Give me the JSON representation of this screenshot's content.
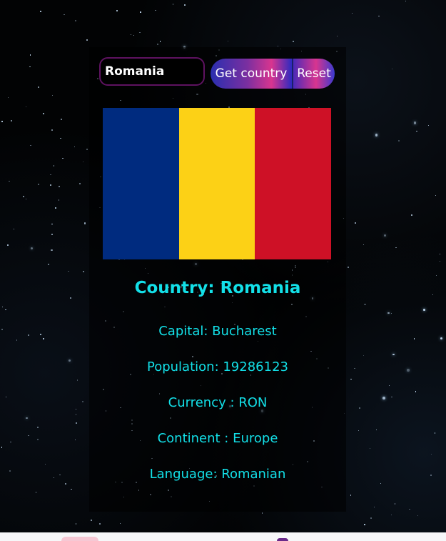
{
  "search": {
    "value": "Romania"
  },
  "buttons": {
    "get_country": "Get country",
    "reset": "Reset"
  },
  "flag": {
    "colors": [
      "#002b7f",
      "#fcd116",
      "#ce1126"
    ]
  },
  "country": {
    "title": "Country: Romania",
    "capital": "Capital: Bucharest",
    "population": "Population: 19286123",
    "currency": "Currency : RON",
    "continent": "Continent : Europe",
    "language": "Language: Romanian"
  },
  "colors": {
    "accent_text": "#13e0e8",
    "input_border": "#5e1260",
    "background": "#000000"
  }
}
